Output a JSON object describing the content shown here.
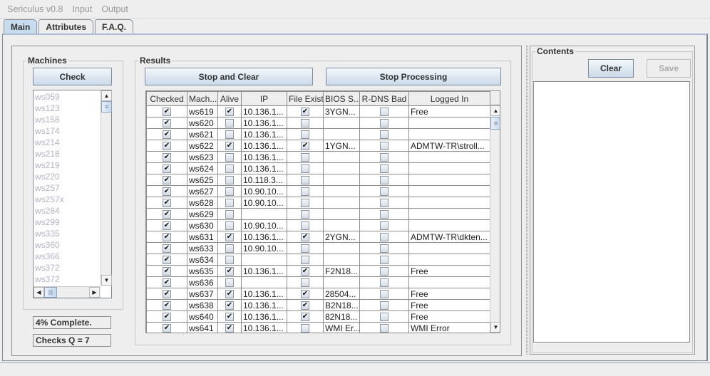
{
  "menubar": {
    "items": [
      "Sericulus v0.8",
      "Input",
      "Output"
    ]
  },
  "tabs": [
    {
      "label": "Main",
      "active": true
    },
    {
      "label": "Attributes",
      "active": false
    },
    {
      "label": "F.A.Q.",
      "active": false
    }
  ],
  "machines": {
    "title": "Machines",
    "check_label": "Check",
    "items": [
      "ws059",
      "ws123",
      "ws158",
      "ws174",
      "ws214",
      "ws218",
      "ws219",
      "ws220",
      "ws257",
      "ws257x",
      "ws284",
      "ws299",
      "ws335",
      "ws360",
      "ws366",
      "ws372",
      "ws372"
    ],
    "progress_text": "4% Complete.",
    "queue_text": "Checks Q = 7"
  },
  "results": {
    "title": "Results",
    "stop_clear_label": "Stop and Clear",
    "stop_processing_label": "Stop Processing",
    "columns": [
      "Checked",
      "Mach...",
      "Alive",
      "IP",
      "File Exist",
      "BIOS S...",
      "R-DNS Bad",
      "Logged In"
    ],
    "rows": [
      {
        "checked": true,
        "machine": "ws619",
        "alive": true,
        "ip": "10.136.1...",
        "file_exist": true,
        "bios": "3YGN...",
        "rdns_bad": false,
        "logged_in": "Free"
      },
      {
        "checked": true,
        "machine": "ws620",
        "alive": false,
        "ip": "10.136.1...",
        "file_exist": false,
        "bios": "",
        "rdns_bad": false,
        "logged_in": ""
      },
      {
        "checked": true,
        "machine": "ws621",
        "alive": false,
        "ip": "10.136.1...",
        "file_exist": false,
        "bios": "",
        "rdns_bad": false,
        "logged_in": ""
      },
      {
        "checked": true,
        "machine": "ws622",
        "alive": true,
        "ip": "10.136.1...",
        "file_exist": true,
        "bios": "1YGN...",
        "rdns_bad": false,
        "logged_in": "ADMTW-TR\\stroll..."
      },
      {
        "checked": true,
        "machine": "ws623",
        "alive": false,
        "ip": "10.136.1...",
        "file_exist": false,
        "bios": "",
        "rdns_bad": false,
        "logged_in": ""
      },
      {
        "checked": true,
        "machine": "ws624",
        "alive": false,
        "ip": "10.136.1...",
        "file_exist": false,
        "bios": "",
        "rdns_bad": false,
        "logged_in": ""
      },
      {
        "checked": true,
        "machine": "ws625",
        "alive": false,
        "ip": "10.118.3...",
        "file_exist": false,
        "bios": "",
        "rdns_bad": false,
        "logged_in": ""
      },
      {
        "checked": true,
        "machine": "ws627",
        "alive": false,
        "ip": "10.90.10...",
        "file_exist": false,
        "bios": "",
        "rdns_bad": false,
        "logged_in": ""
      },
      {
        "checked": true,
        "machine": "ws628",
        "alive": false,
        "ip": "10.90.10...",
        "file_exist": false,
        "bios": "",
        "rdns_bad": false,
        "logged_in": ""
      },
      {
        "checked": true,
        "machine": "ws629",
        "alive": false,
        "ip": "",
        "file_exist": false,
        "bios": "",
        "rdns_bad": false,
        "logged_in": ""
      },
      {
        "checked": true,
        "machine": "ws630",
        "alive": false,
        "ip": "10.90.10...",
        "file_exist": false,
        "bios": "",
        "rdns_bad": false,
        "logged_in": ""
      },
      {
        "checked": true,
        "machine": "ws631",
        "alive": true,
        "ip": "10.136.1...",
        "file_exist": true,
        "bios": "2YGN...",
        "rdns_bad": false,
        "logged_in": "ADMTW-TR\\dkten..."
      },
      {
        "checked": true,
        "machine": "ws633",
        "alive": false,
        "ip": "10.90.10...",
        "file_exist": false,
        "bios": "",
        "rdns_bad": false,
        "logged_in": ""
      },
      {
        "checked": true,
        "machine": "ws634",
        "alive": false,
        "ip": "",
        "file_exist": false,
        "bios": "",
        "rdns_bad": false,
        "logged_in": ""
      },
      {
        "checked": true,
        "machine": "ws635",
        "alive": true,
        "ip": "10.136.1...",
        "file_exist": true,
        "bios": "F2N18...",
        "rdns_bad": false,
        "logged_in": "Free"
      },
      {
        "checked": true,
        "machine": "ws636",
        "alive": false,
        "ip": "",
        "file_exist": false,
        "bios": "",
        "rdns_bad": false,
        "logged_in": ""
      },
      {
        "checked": true,
        "machine": "ws637",
        "alive": true,
        "ip": "10.136.1...",
        "file_exist": true,
        "bios": "28504...",
        "rdns_bad": false,
        "logged_in": "Free"
      },
      {
        "checked": true,
        "machine": "ws638",
        "alive": true,
        "ip": "10.136.1...",
        "file_exist": true,
        "bios": "B2N18...",
        "rdns_bad": false,
        "logged_in": "Free"
      },
      {
        "checked": true,
        "machine": "ws640",
        "alive": true,
        "ip": "10.136.1...",
        "file_exist": true,
        "bios": "82N18...",
        "rdns_bad": false,
        "logged_in": "Free"
      },
      {
        "checked": true,
        "machine": "ws641",
        "alive": true,
        "ip": "10.136.1...",
        "file_exist": false,
        "bios": "WMI Er...",
        "rdns_bad": false,
        "logged_in": "WMI Error"
      }
    ]
  },
  "contents": {
    "title": "Contents",
    "clear_label": "Clear",
    "save_label": "Save",
    "text": ""
  },
  "icons": {
    "check_mark": "✔",
    "arrow_up": "▲",
    "arrow_down": "▼",
    "arrow_left": "◀",
    "arrow_right": "▶",
    "grip": "≡"
  }
}
